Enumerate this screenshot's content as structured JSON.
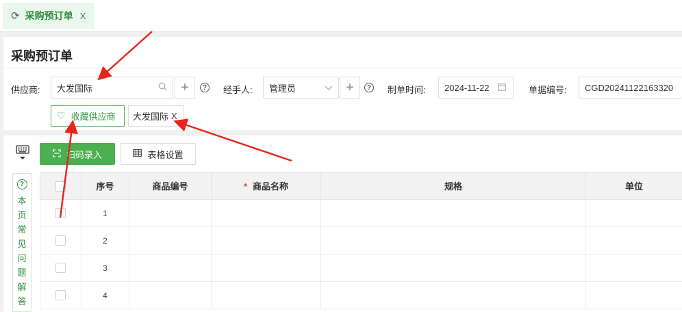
{
  "tab": {
    "label": "采购预订单",
    "close": "X"
  },
  "page": {
    "title": "采购预订单"
  },
  "form": {
    "supplier_label": "供应商:",
    "supplier_value": "大发国际",
    "handler_label": "经手人:",
    "handler_value": "管理员",
    "date_label": "制单时间:",
    "date_value": "2024-11-22",
    "docno_label": "单据编号:",
    "docno_value": "CGD20241122163320",
    "help_mark": "?",
    "plus": "+"
  },
  "favorite": {
    "label": "收藏供应商"
  },
  "supplier_tag": {
    "label": "大发国际",
    "close": "X"
  },
  "toolbar": {
    "scan_label": "扫码录入",
    "table_settings_label": "表格设置"
  },
  "help_strip": {
    "mark": "?",
    "chars": [
      "本",
      "页",
      "常",
      "见",
      "问",
      "题",
      "解",
      "答"
    ]
  },
  "table": {
    "headers": {
      "index": "序号",
      "code": "商品编号",
      "name": "商品名称",
      "spec": "规格",
      "unit": "单位"
    },
    "required_mark": "*",
    "rows": [
      "1",
      "2",
      "3",
      "4"
    ]
  },
  "colors": {
    "accent": "#4caf50",
    "annotation": "#e8251c"
  }
}
